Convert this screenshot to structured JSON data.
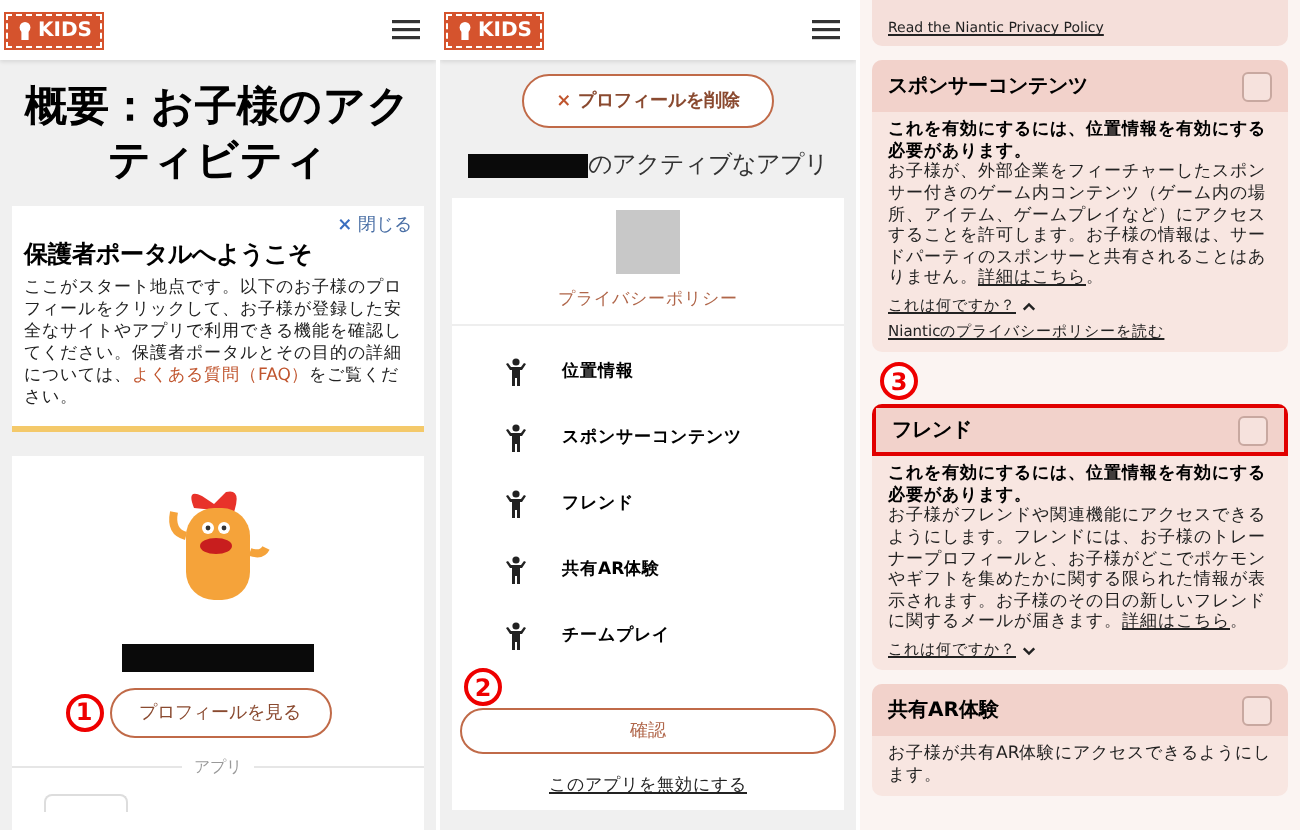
{
  "overview": {
    "header": {
      "logo_text": "KIDS"
    },
    "title": "概要：お子様のアクティビティ",
    "welcome": {
      "close_label": "閉じる",
      "close_icon": "×",
      "title": "保護者ポータルへようこそ",
      "body": "ここがスタート地点です。以下のお子様のプロフィールをクリックして、お子様が登録した安全なサイトやアプリで利用できる機能を確認してください。保護者ポータルとその目的の詳細については、",
      "link": "よくある質問（FAQ）",
      "body_end": "をご覧ください。"
    },
    "profile": {
      "step": "1",
      "button": "プロフィールを見る"
    },
    "apps_divider": "アプリ"
  },
  "app_detail": {
    "header": {
      "logo_text": "KIDS"
    },
    "remove_button": {
      "icon": "×",
      "label": "プロフィールを削除"
    },
    "heading": "のアクティブなアプリ",
    "privacy_link": "プライバシーポリシー",
    "permissions": [
      {
        "name": "位置情報"
      },
      {
        "name": "スポンサーコンテンツ"
      },
      {
        "name": "フレンド"
      },
      {
        "name": "共有AR体験"
      },
      {
        "name": "チームプレイ"
      }
    ],
    "step": "2",
    "confirm_button": "確認",
    "disable_link": "このアプリを無効にする"
  },
  "settings": {
    "top_link": "Read the Niantic Privacy Policy",
    "cards": [
      {
        "title": "スポンサーコンテンツ",
        "checked": false,
        "highlighted": false,
        "requirement": "これを有効にするには、位置情報を有効にする必要があります。",
        "description": "お子様が、外部企業をフィーチャーしたスポンサー付きのゲーム内コンテンツ（ゲーム内の場所、アイテム、ゲームプレイなど）にアクセスすることを許可します。お子様の情報は、サードパーティのスポンサーと共有されることはありません。",
        "detail_link": "詳細はこちら",
        "description_end": "。",
        "more_label": "これは何ですか？",
        "expanded": true,
        "policy_link": "Nianticのプライバシーポリシーを読む"
      },
      {
        "step": "3",
        "title": "フレンド",
        "checked": false,
        "highlighted": true,
        "requirement": "これを有効にするには、位置情報を有効にする必要があります。",
        "description": "お子様がフレンドや関連機能にアクセスできるようにします。フレンドには、お子様のトレーナープロフィールと、お子様がどこでポケモンやギフトを集めたかに関する限られた情報が表示されます。お子様のその日の新しいフレンドに関するメールが届きます。",
        "detail_link": "詳細はこちら",
        "description_end": "。",
        "more_label": "これは何ですか？",
        "expanded": false
      },
      {
        "title": "共有AR体験",
        "checked": false,
        "highlighted": false,
        "description": "お子様が共有AR体験にアクセスできるようにします。"
      }
    ]
  }
}
